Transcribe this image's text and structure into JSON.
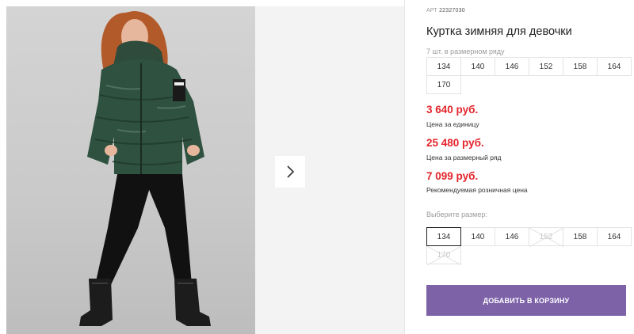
{
  "gallery": {
    "main_image_alt": "girl-in-green-winter-jacket",
    "next_icon": "chevron-right-icon"
  },
  "product": {
    "art_label": "АРТ",
    "art_number": "22327030",
    "title": "Куртка зимняя для девочки",
    "row_count_text": "7 шт. в размерном ряду"
  },
  "size_row": [
    "134",
    "140",
    "146",
    "152",
    "158",
    "164",
    "170"
  ],
  "prices": {
    "unit_price": "3 640 руб.",
    "unit_label": "Цена за единицу",
    "row_price": "25 480 руб.",
    "row_label": "Цена за размерный ряд",
    "retail_price": "7 099 руб.",
    "retail_label": "Рекомендуемая розничная цена",
    "color": "#e3242b"
  },
  "size_select": {
    "label": "Выберите размер:",
    "options": [
      {
        "size": "134",
        "state": "selected"
      },
      {
        "size": "140",
        "state": "available"
      },
      {
        "size": "146",
        "state": "available"
      },
      {
        "size": "152",
        "state": "unavailable"
      },
      {
        "size": "158",
        "state": "available"
      },
      {
        "size": "164",
        "state": "available"
      },
      {
        "size": "170",
        "state": "unavailable"
      }
    ]
  },
  "cart": {
    "button_label": "ДОБАВИТЬ В КОРЗИНУ",
    "color": "#7d62a8"
  }
}
